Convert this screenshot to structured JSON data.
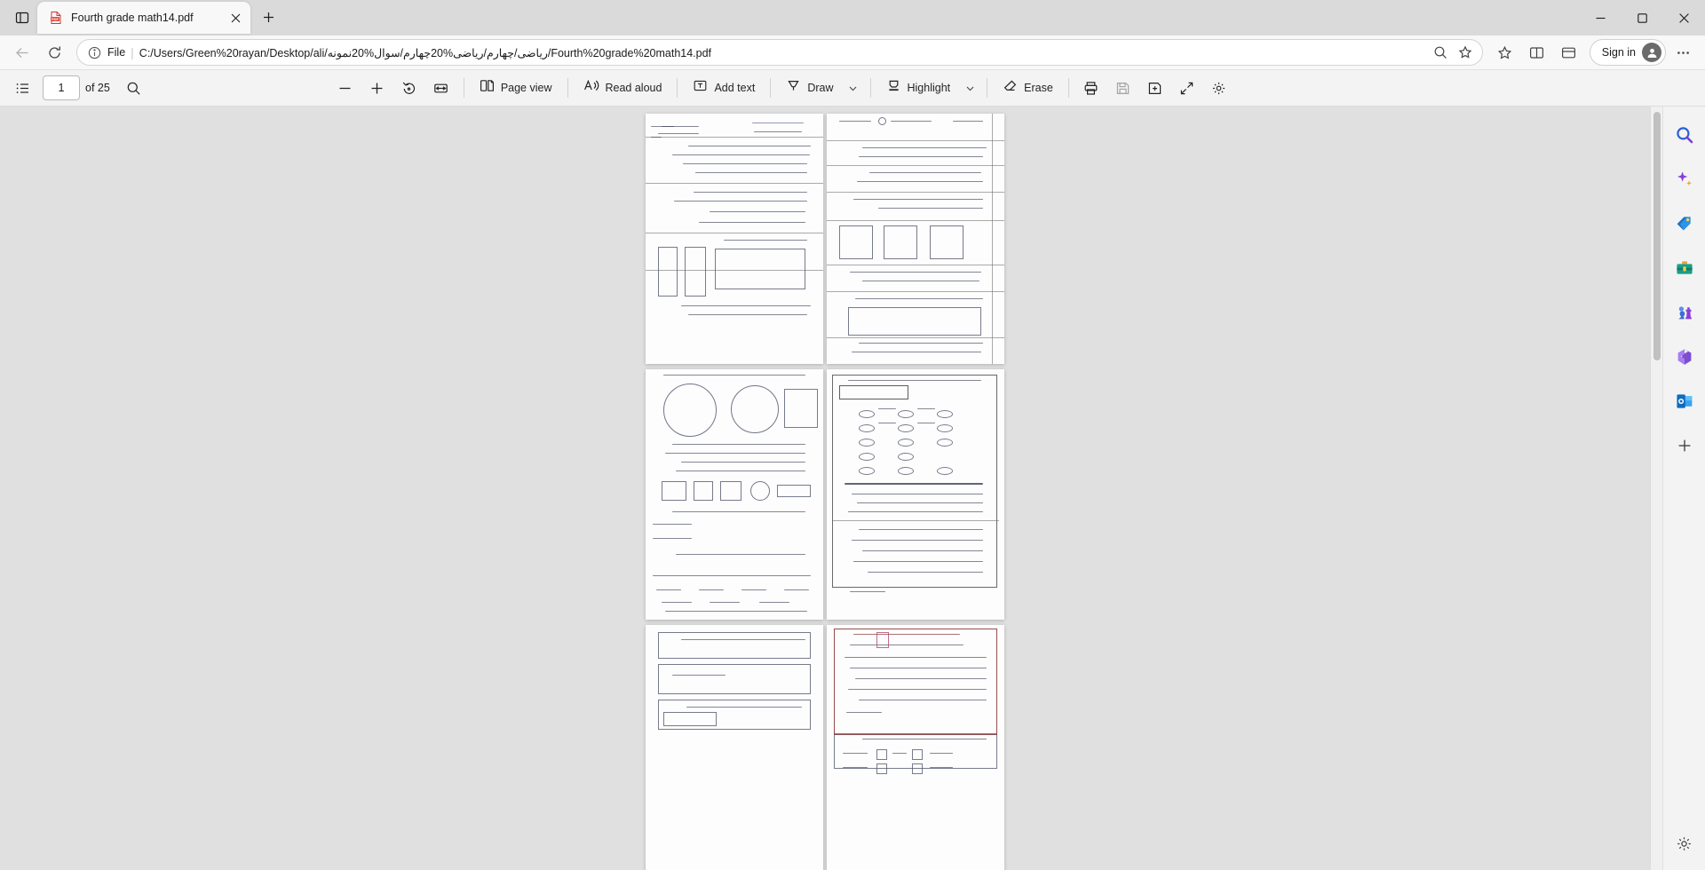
{
  "window": {
    "tab_search_icon": "tab-search-icon",
    "minimize_label": "Minimize",
    "maximize_label": "Maximize",
    "close_label": "Close"
  },
  "tabs": [
    {
      "title": "Fourth grade math14.pdf",
      "favicon": "pdf-file-icon",
      "active": true
    }
  ],
  "newtab_label": "+",
  "navigation": {
    "back_icon": "back-arrow-icon",
    "refresh_icon": "refresh-icon",
    "scheme_label": "File",
    "url": "C:/Users/Green%20rayan/Desktop/ali/ریاضی/چهارم/ریاضی%20چهارم/سوال%20نمونه/Fourth%20grade%20math14.pdf",
    "zoom_icon": "page-zoom-icon",
    "favorite_icon": "add-favorite-star-icon",
    "collections_icon": "collections-icon",
    "split_icon": "split-screen-icon",
    "signin_label": "Sign in",
    "settings_icon": "settings-and-more-icon"
  },
  "pdf_toolbar": {
    "toc_icon": "table-of-contents-icon",
    "page_number": "1",
    "page_count": "of 25",
    "search_icon": "search-icon",
    "zoom_out_icon": "zoom-out-icon",
    "zoom_in_icon": "zoom-in-icon",
    "rotate_icon": "rotate-icon",
    "fit_icon": "fit-to-width-icon",
    "page_view_label": "Page view",
    "page_view_icon": "page-view-icon",
    "read_aloud_label": "Read aloud",
    "read_aloud_icon": "read-aloud-icon",
    "add_text_label": "Add text",
    "add_text_icon": "add-text-icon",
    "draw_label": "Draw",
    "draw_icon": "draw-pen-icon",
    "draw_caret": "chevron-down-icon",
    "highlight_label": "Highlight",
    "highlight_icon": "highlighter-icon",
    "highlight_caret": "chevron-down-icon",
    "erase_label": "Erase",
    "erase_icon": "eraser-icon",
    "print_icon": "print-icon",
    "save_icon": "save-icon",
    "save_as_icon": "save-as-icon",
    "fullscreen_icon": "fullscreen-icon",
    "more_settings_icon": "pdf-settings-icon"
  },
  "sidebar": {
    "items": [
      {
        "name": "search-icon",
        "label": "Search"
      },
      {
        "name": "copilot-icon",
        "label": "Copilot"
      },
      {
        "name": "shopping-tag-icon",
        "label": "Shopping"
      },
      {
        "name": "tools-icon",
        "label": "Tools"
      },
      {
        "name": "games-icon",
        "label": "Games"
      },
      {
        "name": "microsoft-365-icon",
        "label": "Microsoft 365"
      },
      {
        "name": "outlook-icon",
        "label": "Outlook"
      },
      {
        "name": "add-sidebar-app-icon",
        "label": "Customize"
      }
    ],
    "settings_icon": "sidebar-settings-icon"
  },
  "document": {
    "scroll_position_percent": 4,
    "pages": [
      {
        "index": 1,
        "kind": "scanned-worksheet-left"
      },
      {
        "index": 2,
        "kind": "scanned-worksheet-right"
      },
      {
        "index": 3,
        "kind": "scanned-worksheet-left"
      },
      {
        "index": 4,
        "kind": "scanned-form-right"
      },
      {
        "index": 5,
        "kind": "scanned-worksheet-left"
      },
      {
        "index": 6,
        "kind": "scanned-exam-right"
      }
    ]
  },
  "colors": {
    "accent": "#0067c0",
    "titlebar_bg": "#dadada",
    "toolbar_bg": "#f3f3f3",
    "viewer_bg": "#e0e0e0",
    "page_bg": "#ffffff",
    "close_hover": "#e81123"
  }
}
